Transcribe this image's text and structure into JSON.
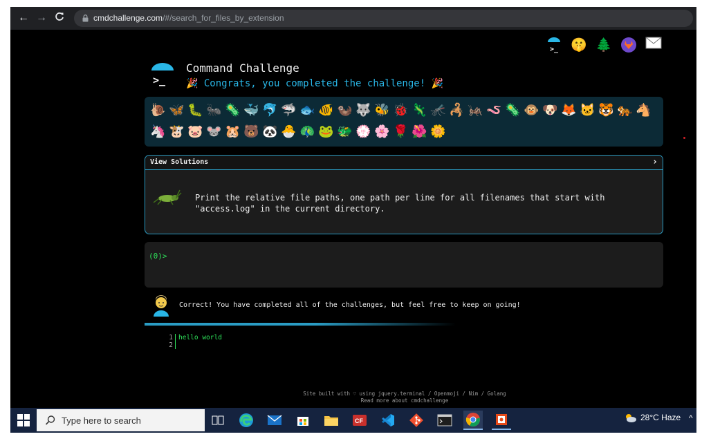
{
  "browser": {
    "url_domain": "cmdchallenge.com",
    "url_path": "/#/search_for_files_by_extension",
    "back_icon": "arrow-left-icon",
    "forward_icon": "arrow-right-icon",
    "reload_icon": "reload-icon"
  },
  "header": {
    "title": "Command Challenge",
    "congrats": "🎉 Congrats, you completed the challenge! 🎉",
    "top_icons": [
      "terminal-umbrella-icon",
      "shushing-face-icon",
      "christmas-tree-icon",
      "gitlab-icon",
      "envelope-icon"
    ]
  },
  "emoji_panel": {
    "row1": [
      "🐌",
      "🦋",
      "🐛",
      "🐜",
      "🦠",
      "🐳",
      "🐬",
      "🦈",
      "🐟",
      "🐠",
      "🦦",
      "🐺",
      "🐝",
      "🐞",
      "🦎",
      "🦟",
      "🦂",
      "🦗",
      "🪱",
      "🦠",
      "🐵",
      "🐶"
    ],
    "row2": [
      "🦊",
      "🐱",
      "🐯",
      "🐅",
      "🐴",
      "🦄",
      "🐮",
      "🐷",
      "🐭",
      "🐹",
      "🐻",
      "🐼",
      "🐣",
      "🦚",
      "🐸",
      "🐲",
      "💮",
      "🌸",
      "🌹",
      "🌺",
      "🌼"
    ]
  },
  "challenge": {
    "view_solutions_label": "View Solutions",
    "view_solutions_chevron": "›",
    "description": "Print the relative file paths, one path per line for all filenames that start with\n\"access.log\" in the current directory."
  },
  "terminal": {
    "prompt": "(0)>"
  },
  "result": {
    "message": "Correct! You have completed all of the challenges, but feel free to keep on going!"
  },
  "output": {
    "lines": [
      {
        "number": "1",
        "text": "hello world"
      },
      {
        "number": "2",
        "text": ""
      }
    ]
  },
  "footer": {
    "line1": "Site built with ♡ using jquery.terminal / Openmoji / Nim / Golang",
    "line2": "Read more about cmdchallenge"
  },
  "taskbar": {
    "search_placeholder": "Type here to search",
    "weather": "28°C Haze",
    "tray_chevron": "^",
    "apps": [
      "task-view-icon",
      "edge-icon",
      "mail-icon",
      "store-icon",
      "file-explorer-icon",
      "cf-app-icon",
      "vscode-icon",
      "git-icon",
      "terminal-icon",
      "chrome-icon",
      "office-icon"
    ]
  }
}
